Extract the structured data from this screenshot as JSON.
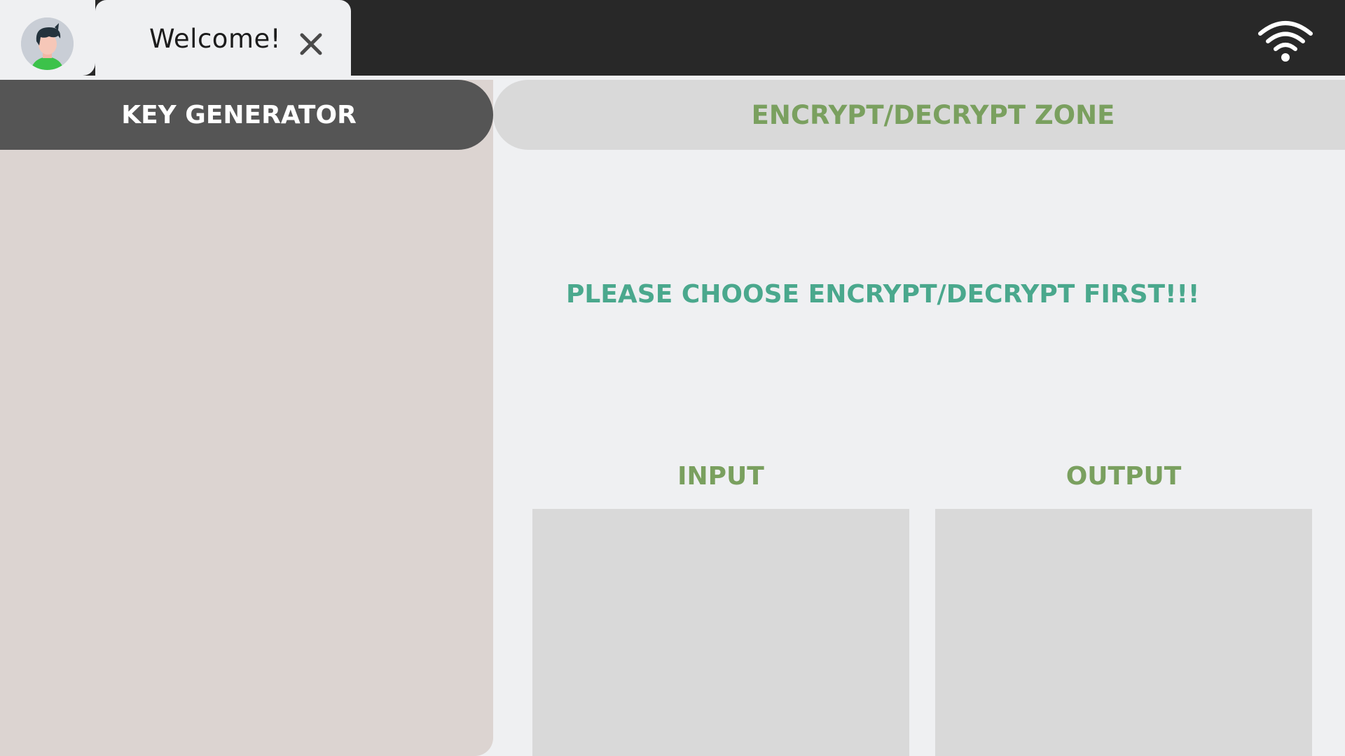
{
  "header": {
    "tab_title": "Welcome!",
    "close_icon": "close-icon",
    "avatar_icon": "user-avatar",
    "wifi_icon": "wifi-icon"
  },
  "tabs": {
    "key_generator": "KEY GENERATOR",
    "encrypt_zone": "ENCRYPT/DECRYPT ZONE"
  },
  "main": {
    "notice": "PLEASE CHOOSE ENCRYPT/DECRYPT FIRST!!!",
    "input_label": "INPUT",
    "output_label": "OUTPUT",
    "input_value": "",
    "output_value": ""
  },
  "colors": {
    "topbar": "#282828",
    "key_tab": "#555555",
    "left_panel": "#dcd4d1",
    "zone_tab": "#d9d9d9",
    "accent_green": "#7aa05f",
    "notice_teal": "#4aa88d"
  }
}
